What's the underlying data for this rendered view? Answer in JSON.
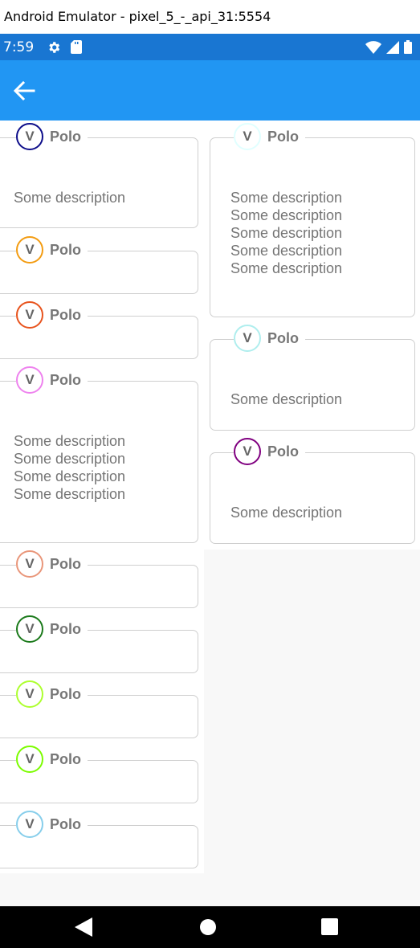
{
  "window": {
    "title": "Android Emulator - pixel_5_-_api_31:5554"
  },
  "status_bar": {
    "time": "7:59"
  },
  "left_cards": [
    {
      "initial": "V",
      "title": "Polo",
      "ring_color": "#0d0d8a",
      "description": "Some description"
    },
    {
      "initial": "V",
      "title": "Polo",
      "ring_color": "#f39c12",
      "description": ""
    },
    {
      "initial": "V",
      "title": "Polo",
      "ring_color": "#e8541e",
      "description": ""
    },
    {
      "initial": "V",
      "title": "Polo",
      "ring_color": "#ee82ee",
      "description": "Some description\nSome description\nSome description\nSome description"
    },
    {
      "initial": "V",
      "title": "Polo",
      "ring_color": "#e9967a",
      "description": ""
    },
    {
      "initial": "V",
      "title": "Polo",
      "ring_color": "#1b7a1b",
      "description": ""
    },
    {
      "initial": "V",
      "title": "Polo",
      "ring_color": "#adff2f",
      "description": ""
    },
    {
      "initial": "V",
      "title": "Polo",
      "ring_color": "#7cfc00",
      "description": ""
    },
    {
      "initial": "V",
      "title": "Polo",
      "ring_color": "#87ceeb",
      "description": ""
    }
  ],
  "right_cards": [
    {
      "initial": "V",
      "title": "Polo",
      "ring_color": "#e0ffff",
      "description": "Some description\nSome description\nSome description\nSome description\nSome description"
    },
    {
      "initial": "V",
      "title": "Polo",
      "ring_color": "#afeeee",
      "description": "Some description"
    },
    {
      "initial": "V",
      "title": "Polo",
      "ring_color": "#800080",
      "description": "Some description"
    }
  ]
}
